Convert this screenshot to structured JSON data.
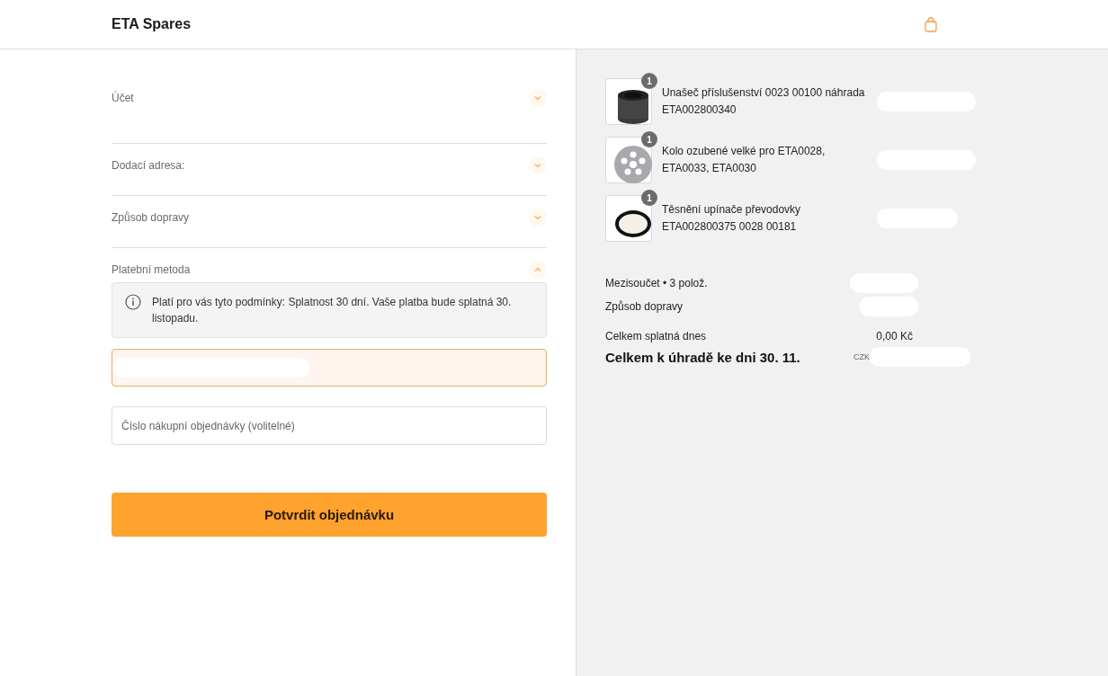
{
  "header": {
    "brand": "ETA Spares"
  },
  "sections": [
    {
      "title": "Účet",
      "expanded": false
    },
    {
      "title": "Dodací adresa:",
      "expanded": false
    },
    {
      "title": "Způsob dopravy",
      "expanded": false
    },
    {
      "title": "Platební metoda",
      "expanded": true
    }
  ],
  "payment_notice": "Platí pro vás tyto podmínky: Splatnost 30 dní. Vaše platba bude splatná 30. listopadu.",
  "po_field": {
    "placeholder": "Číslo nákupní objednávky (volitelné)"
  },
  "confirm_button": "Potvrdit objednávku",
  "items": [
    {
      "kind": "sleeve",
      "quantity": "1",
      "name": "Unašeč příslušenství 0023 00100 náhrada ETA002800340"
    },
    {
      "kind": "gear",
      "quantity": "1",
      "name": "Kolo ozubené velké pro ETA0028, ETA0033, ETA0030"
    },
    {
      "kind": "ring",
      "quantity": "1",
      "name": "Těsnění upínače převodovky ETA002800375 0028 00181"
    }
  ],
  "summary": {
    "subtotal_label": "Mezisoučet • 3 polož.",
    "shipping_label": "Způsob dopravy",
    "due_today_label": "Celkem splatná dnes",
    "due_today_value": "0,00 Kč",
    "total_label": "Celkem k úhradě ke dni 30. 11.",
    "currency": "CZK"
  }
}
